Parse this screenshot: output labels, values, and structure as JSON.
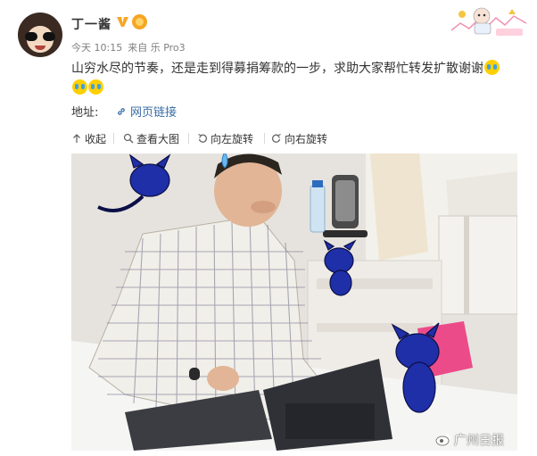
{
  "post": {
    "username": "丁一酱",
    "meta_time": "今天 10:15",
    "meta_source": "来自 乐 Pro3",
    "text": "山穷水尽的节奏，还是走到得募捐筹款的一步，求助大家帮忙转发扩散谢谢",
    "address_label": "地址:",
    "address_link": "网页链接"
  },
  "toolbar": {
    "collapse_label": "收起",
    "view_large_label": "查看大图",
    "rotate_left_label": "向左旋转",
    "rotate_right_label": "向右旋转"
  },
  "photo": {
    "watermark_text": "广州日报"
  },
  "icons": {
    "verified": "verified-v-icon",
    "medal": "medal-icon",
    "emoji": "crying-emoji-icon",
    "link": "link-icon",
    "collapse": "collapse-arrow-icon",
    "zoom": "magnifier-icon",
    "rotate_left": "rotate-left-icon",
    "rotate_right": "rotate-right-icon",
    "weibo": "weibo-logo-icon"
  },
  "colors": {
    "link": "#3a6ea5",
    "verified": "#f5a623",
    "meta": "#808080",
    "text": "#333333",
    "cartoon_cat": "#1f2fa8"
  }
}
